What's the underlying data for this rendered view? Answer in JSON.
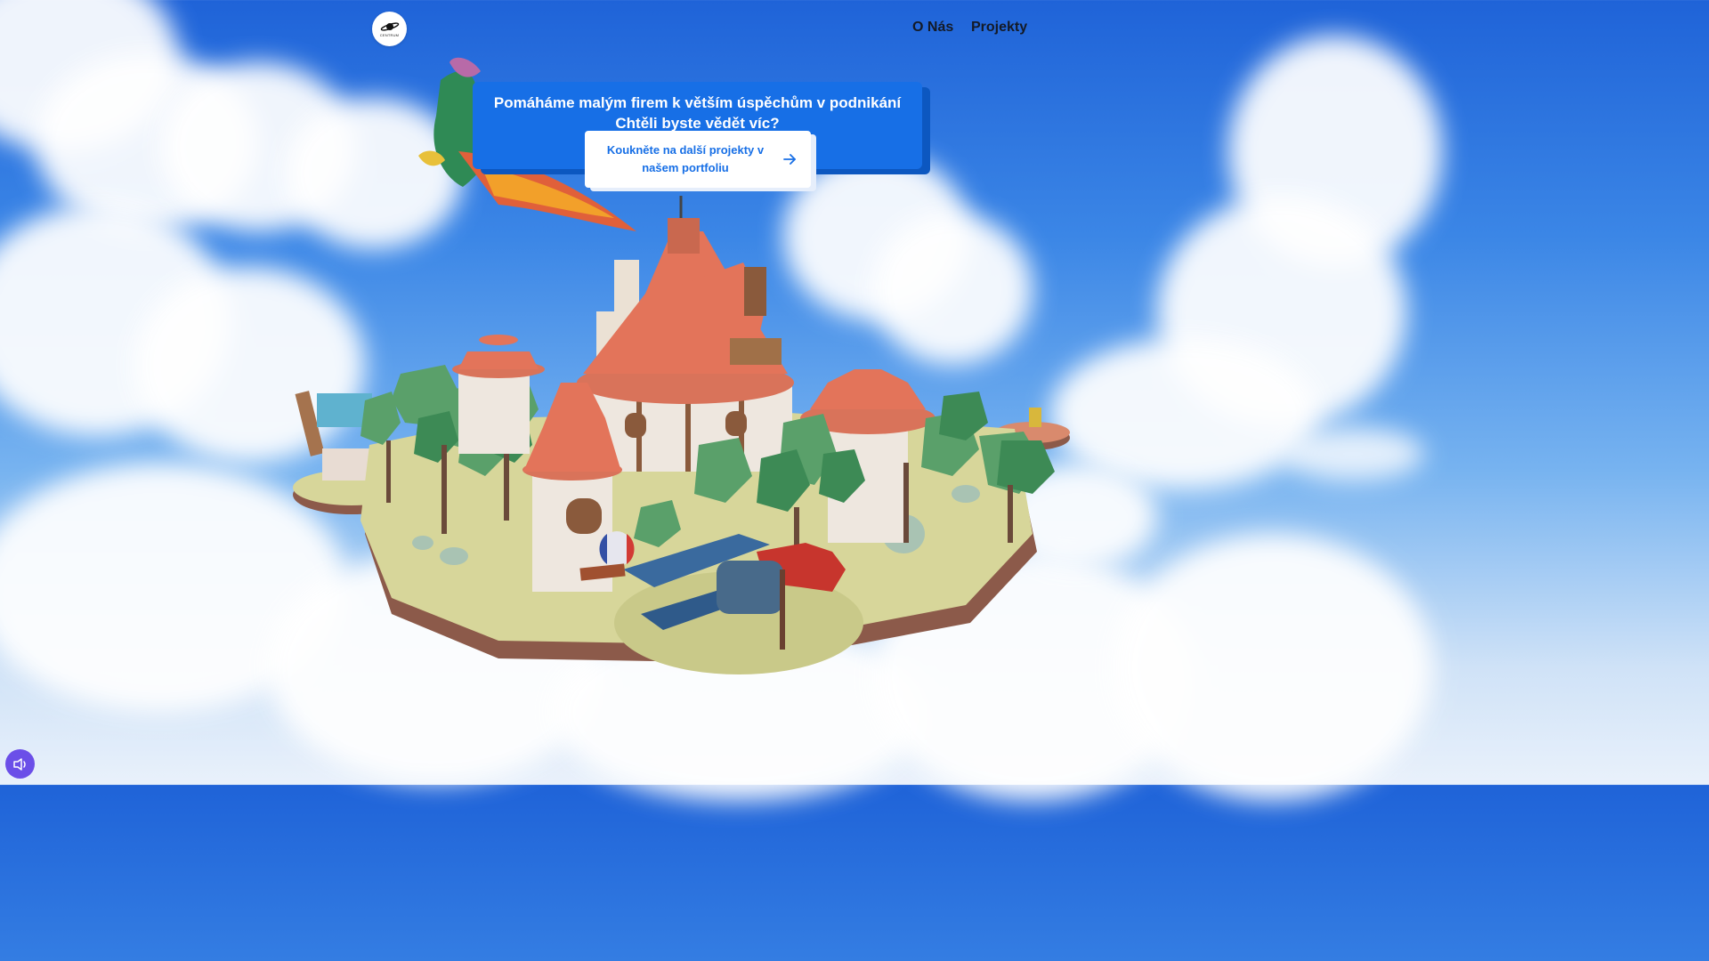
{
  "nav": {
    "logo_text": "CENTRUM",
    "links": [
      "O Nás",
      "Projekty"
    ]
  },
  "hero": {
    "headline_line1": "Pomáháme malým firem k větším úspěchům v podnikání",
    "headline_line2": "Chtěli byste vědět víc?",
    "cta_line1": "Koukněte na další projekty v",
    "cta_line2": "našem portfoliu"
  },
  "icons": {
    "cta": "arrow-right-icon",
    "sound": "speaker-icon",
    "logo": "planet-icon"
  },
  "colors": {
    "banner": "#176fe6",
    "cta_text": "#176fe6",
    "sound_button": "#6b4fe8",
    "roof": "#e3745a",
    "grass": "#d7d69a"
  }
}
